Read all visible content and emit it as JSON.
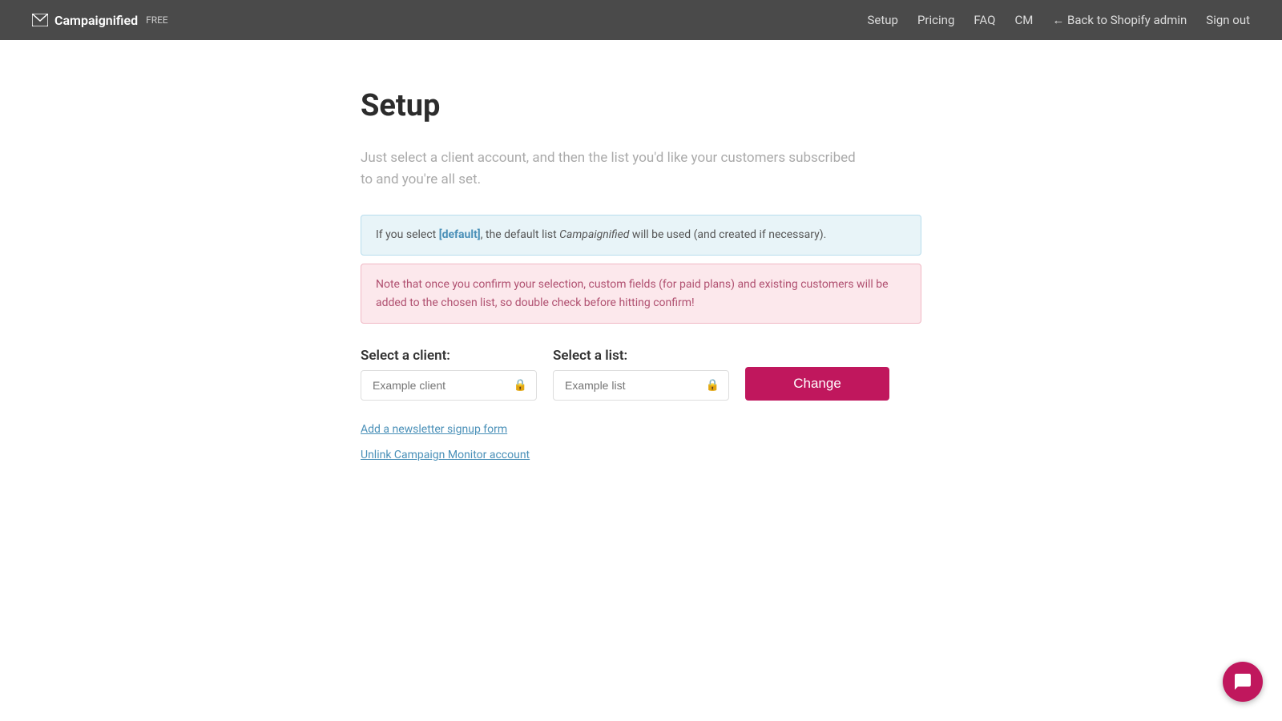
{
  "header": {
    "brand_name": "Campaignified",
    "brand_free": "FREE",
    "nav": {
      "setup": "Setup",
      "pricing": "Pricing",
      "faq": "FAQ",
      "cm": "CM",
      "back_to_shopify": "← Back to Shopify admin",
      "sign_out": "Sign out"
    }
  },
  "main": {
    "page_title": "Setup",
    "description": "Just select a client account, and then the list you'd like your customers subscribed to and you're all set.",
    "info_blue": {
      "prefix": "If you select ",
      "bold": "[default]",
      "suffix": ", the default list ",
      "italic": "Campaignified",
      "end": " will be used (and created if necessary)."
    },
    "info_pink": "Note that once you confirm your selection, custom fields (for paid plans) and existing customers will be added to the chosen list, so double check before hitting confirm!",
    "client_label": "Select a client:",
    "client_placeholder": "Example client",
    "list_label": "Select a list:",
    "list_placeholder": "Example list",
    "change_button": "Change",
    "link_signup": "Add a newsletter signup form",
    "link_unlink": "Unlink Campaign Monitor account"
  },
  "chat": {
    "icon": "chat-icon"
  }
}
